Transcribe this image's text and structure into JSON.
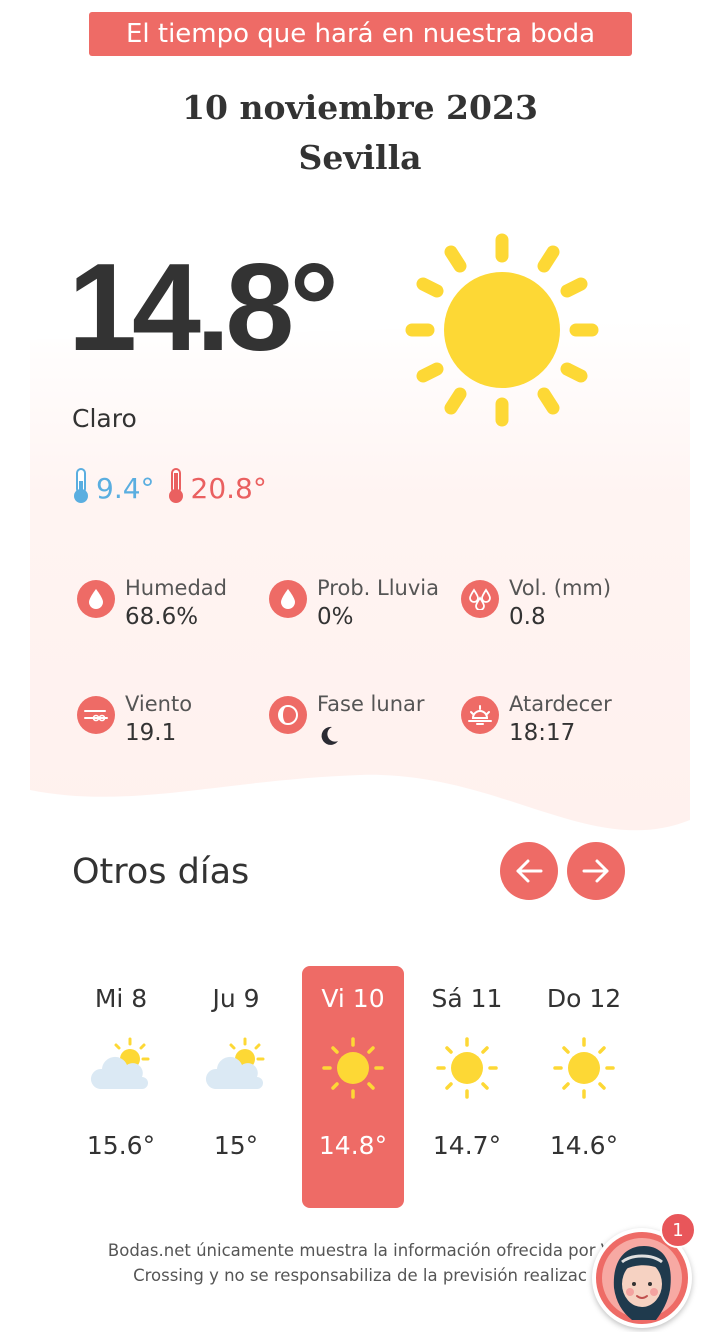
{
  "banner": "El tiempo que hará en nuestra boda",
  "header": {
    "date": "10 noviembre 2023",
    "city": "Sevilla"
  },
  "current": {
    "temperature": "14.8°",
    "condition": "Claro",
    "min": "9.4°",
    "max": "20.8°",
    "icon": "sun-icon"
  },
  "stats": [
    {
      "label": "Humedad",
      "value": "68.6%",
      "icon": "humidity-drop-icon"
    },
    {
      "label": "Prob. Lluvia",
      "value": "0%",
      "icon": "rain-drop-icon"
    },
    {
      "label": "Vol. (mm)",
      "value": "0.8",
      "icon": "rain-volume-icon"
    },
    {
      "label": "Viento",
      "value": "19.1",
      "icon": "wind-icon"
    },
    {
      "label": "Fase lunar",
      "value": "",
      "icon": "moon-phase-icon"
    },
    {
      "label": "Atardecer",
      "value": "18:17",
      "icon": "sunset-icon"
    }
  ],
  "other_days": {
    "title": "Otros días",
    "prev_icon": "arrow-left-icon",
    "next_icon": "arrow-right-icon",
    "days": [
      {
        "name": "Mi 8",
        "temp": "15.6°",
        "icon": "partly-cloudy-icon",
        "active": false
      },
      {
        "name": "Ju 9",
        "temp": "15°",
        "icon": "partly-cloudy-icon",
        "active": false
      },
      {
        "name": "Vi 10",
        "temp": "14.8°",
        "icon": "sun-icon",
        "active": true
      },
      {
        "name": "Sá 11",
        "temp": "14.7°",
        "icon": "sun-icon",
        "active": false
      },
      {
        "name": "Do 12",
        "temp": "14.6°",
        "icon": "sun-icon",
        "active": false
      }
    ]
  },
  "footer": {
    "line1": "Bodas.net únicamente muestra la información ofrecida por V",
    "line2": "Crossing y no se responsabiliza de la previsión realizac"
  },
  "chat": {
    "badge": "1",
    "icon": "assistant-avatar-icon"
  },
  "colors": {
    "accent": "#ee6b66",
    "sun": "#fdd835",
    "cold": "#5aaee0",
    "hot": "#ea6060",
    "panel": "#fff3f1"
  }
}
